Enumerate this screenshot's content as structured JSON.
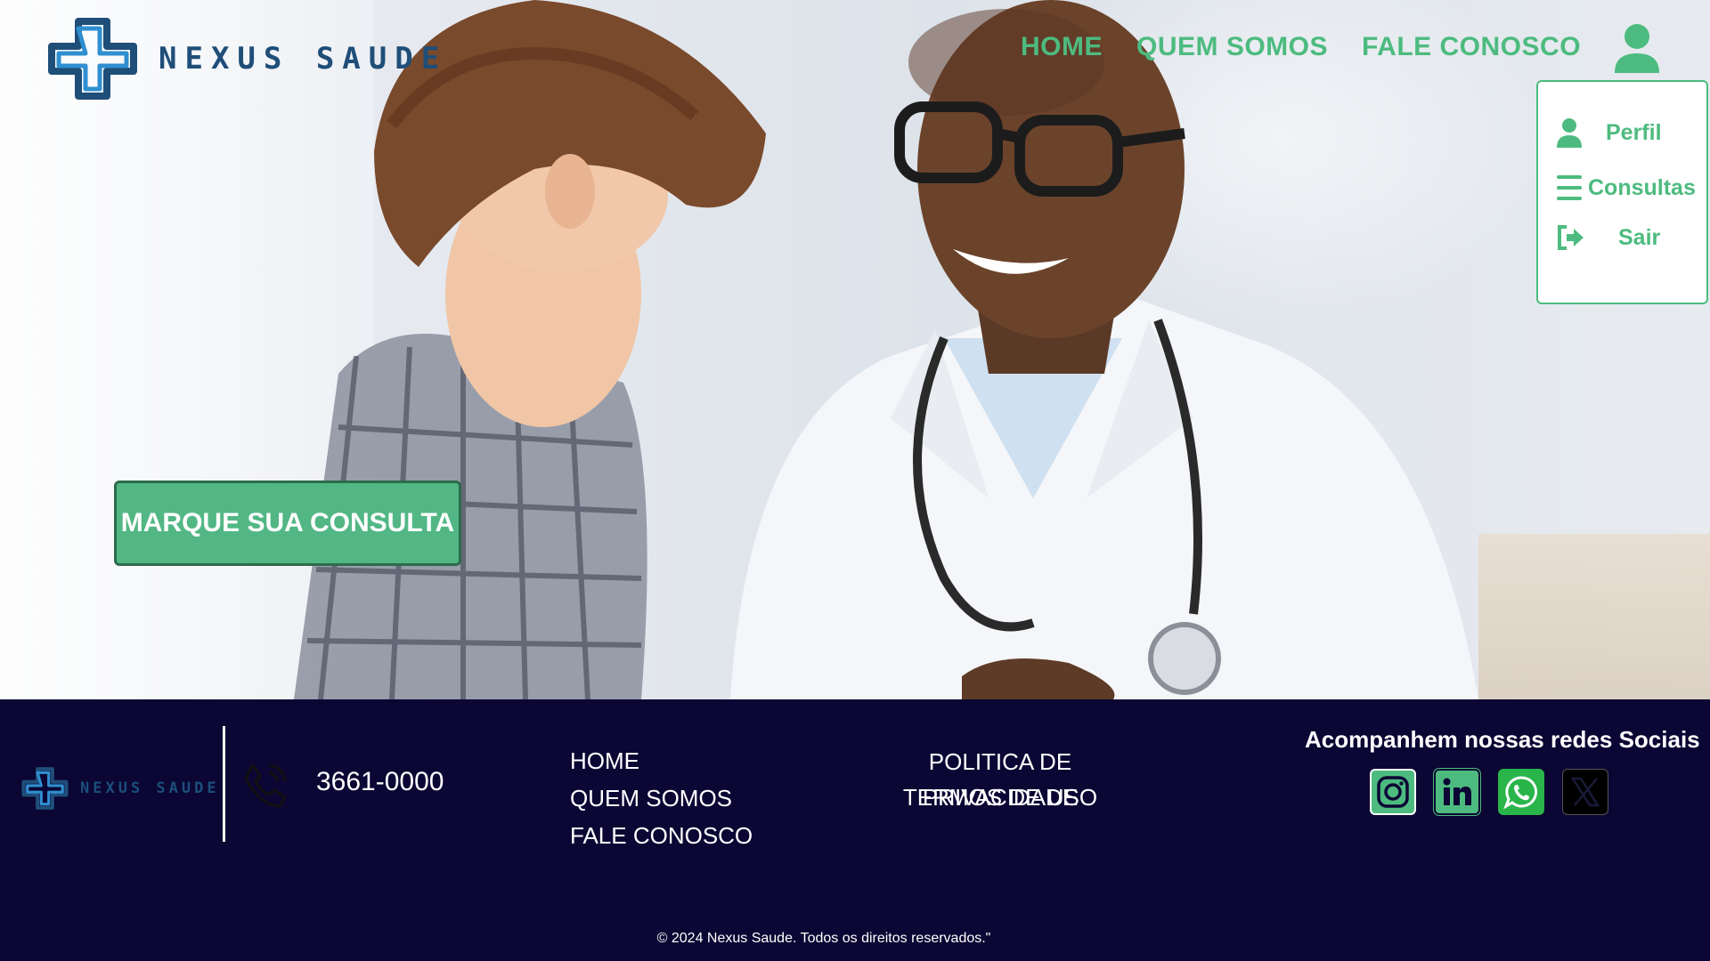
{
  "brand": {
    "name": "NEXUS SAUDE"
  },
  "nav": {
    "items": [
      {
        "label": "HOME"
      },
      {
        "label": "QUEM SOMOS"
      },
      {
        "label": "FALE CONOSCO"
      }
    ],
    "user_icon": "user-icon"
  },
  "user_menu": {
    "items": [
      {
        "label": "Perfil",
        "icon": "user-icon"
      },
      {
        "label": "Consultas",
        "icon": "list-icon"
      },
      {
        "label": "Sair",
        "icon": "logout-icon"
      }
    ]
  },
  "hero": {
    "cta_label": "MARQUE SUA CONSULTA"
  },
  "footer": {
    "brand": "NEXUS SAUDE",
    "phone": "3661-0000",
    "links": [
      {
        "label": "HOME"
      },
      {
        "label": "QUEM SOMOS"
      },
      {
        "label": "FALE CONOSCO"
      }
    ],
    "legal": [
      {
        "label": "POLITICA DE PRIVACIDADE"
      },
      {
        "label": "TERMOS DE USO"
      }
    ],
    "social_title": "Acompanhem nossas redes Sociais",
    "socials": [
      "instagram-icon",
      "linkedin-icon",
      "whatsapp-icon",
      "x-icon"
    ],
    "copyright": "© 2024 Nexus Saude. Todos os direitos reservados.\""
  },
  "colors": {
    "accent": "#4dbb7f",
    "footer_bg": "#0b0633",
    "logo_blue": "#1f4e79"
  }
}
